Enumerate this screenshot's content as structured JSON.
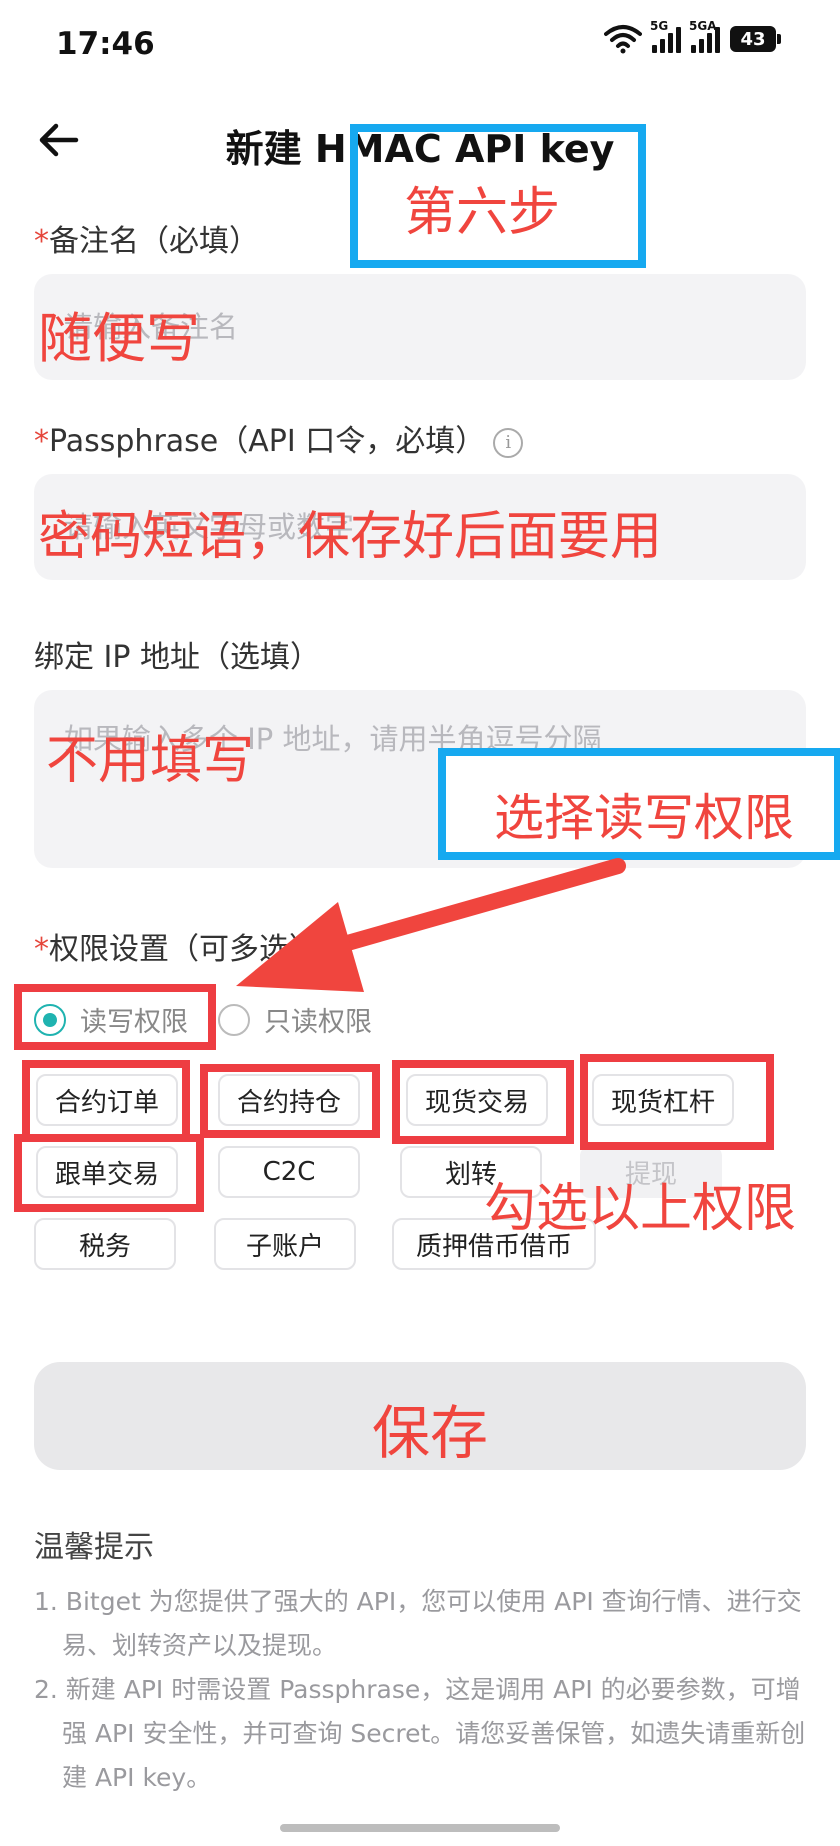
{
  "status_bar": {
    "time": "17:46",
    "signal_1": "5G",
    "signal_2": "5GA",
    "battery": "43"
  },
  "header": {
    "title": "新建 HMAC API key"
  },
  "form": {
    "remark": {
      "required": "*",
      "label": "备注名（必填）",
      "placeholder": "请输入备注名"
    },
    "passphrase": {
      "required": "*",
      "label": "Passphrase（API 口令，必填）",
      "placeholder": "请输入英文字母或数字"
    },
    "ip": {
      "label": "绑定 IP 地址（选填）",
      "placeholder": "如果输入多个 IP 地址，请用半角逗号分隔"
    },
    "permissions": {
      "required": "*",
      "label": "权限设置（可多选）",
      "modes": [
        {
          "label": "读写权限",
          "selected": true
        },
        {
          "label": "只读权限",
          "selected": false
        }
      ],
      "chips": [
        "合约订单",
        "合约持仓",
        "现货交易",
        "现货杠杆",
        "跟单交易",
        "C2C",
        "划转",
        "提现",
        "税务",
        "子账户",
        "质押借币借币"
      ]
    }
  },
  "save_button": {
    "label": "保存"
  },
  "tips": {
    "title": "温馨提示",
    "items": [
      "1. Bitget 为您提供了强大的 API，您可以使用 API 查询行情、进行交易、划转资产以及提现。",
      "2. 新建 API 时需设置 Passphrase，这是调用 API 的必要参数，可增强 API 安全性，并可查询 Secret。请您妥善保管，如遗失请重新创建 API key。"
    ]
  },
  "annotations": {
    "step": "第六步",
    "remark_hint": "随便写",
    "passphrase_hint": "密码短语，保存好后面要用",
    "ip_hint": "不用填写",
    "permission_hint": "选择读写权限",
    "chips_hint": "勾选以上权限",
    "save_hint": "保存",
    "red": "#ee3d42",
    "blue": "#16a9f0"
  }
}
